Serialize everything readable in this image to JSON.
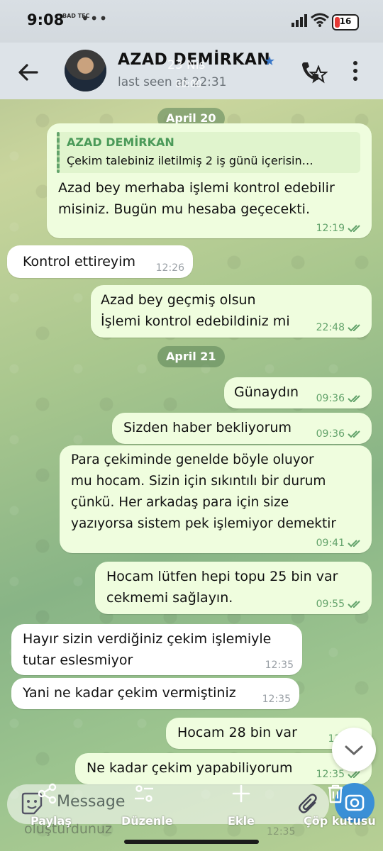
{
  "status": {
    "time": "9:08",
    "small_info": "BAD TEC",
    "extra": "•••",
    "battery": "16"
  },
  "header": {
    "contact_name": "AZAD DEMİRKAN",
    "last_seen": "last seen at 22:31",
    "overlay_date": "23 Nis",
    "overlay_sub": "00:00"
  },
  "dates": [
    "April 20",
    "April 21"
  ],
  "reply_preview": {
    "name": "AZAD DEMİRKAN",
    "text": "Çekim talebiniz iletilmiş 2 iş günü içerisin…"
  },
  "messages": [
    {
      "text": "Azad bey merhaba işlemi kontrol edebilir\nmisiniz. Bugün mu hesaba geçecekti.",
      "time": "12:19",
      "dir": "out"
    },
    {
      "text": "Kontrol ettireyim",
      "time": "12:26",
      "dir": "in"
    },
    {
      "text": "Azad bey geçmiş olsun\nİşlemi kontrol edebildiniz mi",
      "time": "22:48",
      "dir": "out"
    },
    {
      "text": "Günaydın",
      "time": "09:36",
      "dir": "out"
    },
    {
      "text": "Sizden haber bekliyorum",
      "time": "09:36",
      "dir": "out"
    },
    {
      "text": "Para çekiminde genelde böyle oluyor\nmu hocam. Sizin için sıkıntılı bir durum\nçünkü. Her arkadaş para için size\nyazıyorsa sistem pek işlemiyor demektir",
      "time": "09:41",
      "dir": "out"
    },
    {
      "text": "Hocam lütfen hepi topu 25 bin var\ncekmemi sağlayın.",
      "time": "09:55",
      "dir": "out"
    },
    {
      "text": "Hayır sizin verdiğiniz çekim işlemiyle\ntutar eslesmiyor",
      "time": "12:35",
      "dir": "in"
    },
    {
      "text": "Yani ne kadar çekim vermiştiniz",
      "time": "12:35",
      "dir": "in"
    },
    {
      "text": "Hocam 28 bin var",
      "time": "12:3",
      "dir": "out"
    },
    {
      "text": "Ne kadar çekim yapabiliyorum",
      "time": "12:35",
      "dir": "out"
    }
  ],
  "input": {
    "placeholder": "Message"
  },
  "toolbar": {
    "share": "Paylaş",
    "edit": "Düzenle",
    "add": "Ekle",
    "trash": "Çöp kutusu"
  },
  "ghost": {
    "text": "oluşturdunuz",
    "time": "12:35"
  },
  "colors": {
    "outgoing": "#effdde",
    "incoming": "#ffffff",
    "accent": "#3a8fd6",
    "tick": "#63a36b"
  },
  "icons": [
    "back-arrow-icon",
    "star-icon",
    "phone-icon",
    "more-icon",
    "read-ticks-icon",
    "chevron-down-icon",
    "sticker-icon",
    "attach-icon",
    "camera-icon",
    "share-icon",
    "edit-icon",
    "plus-icon",
    "trash-icon"
  ]
}
